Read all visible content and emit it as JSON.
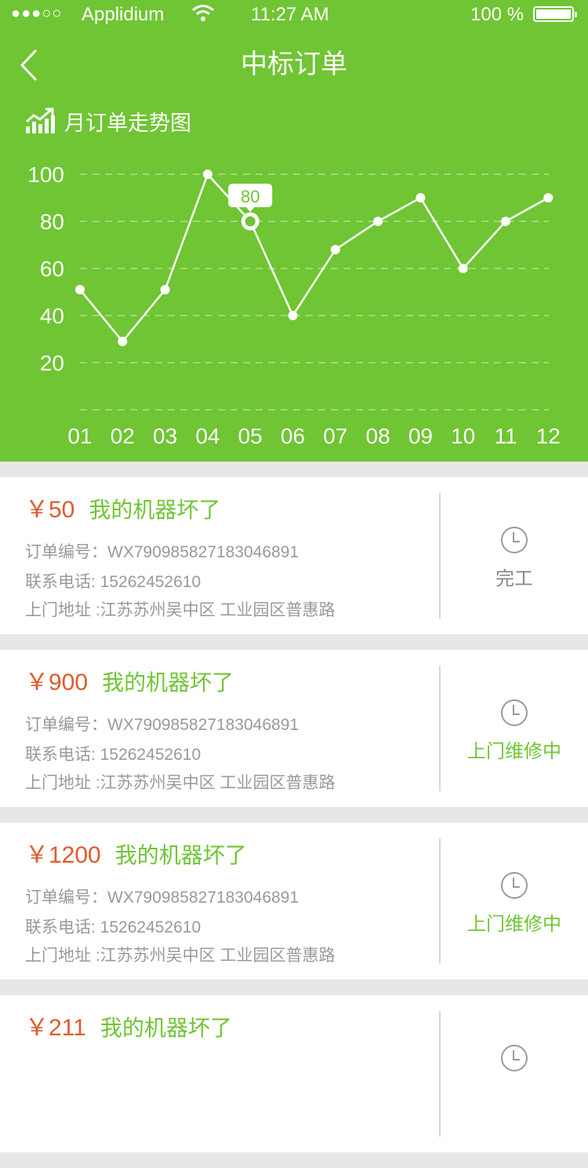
{
  "status_bar": {
    "signal": "●●●○○",
    "carrier": "Applidium",
    "time": "11:27 AM",
    "battery": "100 %"
  },
  "nav": {
    "title": "中标订单",
    "back_icon": "chevron-left-icon"
  },
  "chart_section": {
    "title": "月订单走势图",
    "icon": "trend-chart-icon"
  },
  "chart_data": {
    "type": "line",
    "title": "月订单走势图",
    "x": [
      "01",
      "02",
      "03",
      "04",
      "05",
      "06",
      "07",
      "08",
      "09",
      "10",
      "11",
      "12"
    ],
    "values": [
      51,
      29,
      51,
      100,
      80,
      40,
      68,
      80,
      90,
      60,
      80,
      90
    ],
    "y_ticks": [
      100,
      80,
      60,
      40,
      20
    ],
    "ylim": [
      0,
      100
    ],
    "grid": true,
    "highlight": {
      "index": 4,
      "label": "80"
    },
    "colors": {
      "background": "#6fc533",
      "line": "#ffffff"
    }
  },
  "orders": [
    {
      "price": "￥50",
      "title": "我的机器坏了",
      "order_no": "订单编号：WX79098582718304689​1",
      "phone": "联系电话:  15262452610",
      "address": "上门地址 :江苏苏州吴中区 工业园区普惠路",
      "status": "完工",
      "status_type": "done"
    },
    {
      "price": "￥900",
      "title": "我的机器坏了",
      "order_no": "订单编号：WX79098582718304689​1",
      "phone": "联系电话:  15262452610",
      "address": "上门地址 :江苏苏州吴中区 工业园区普惠路",
      "status": "上门维修中",
      "status_type": "active"
    },
    {
      "price": "￥1200",
      "title": "我的机器坏了",
      "order_no": "订单编号：WX79098582718304689​1",
      "phone": "联系电话:  15262452610",
      "address": "上门地址 :江苏苏州吴中区 工业园区普惠路",
      "status": "上门维修中",
      "status_type": "active"
    },
    {
      "price": "￥211",
      "title": "我的机器坏了",
      "order_no": "",
      "phone": "",
      "address": "",
      "status": "",
      "status_type": "active"
    }
  ]
}
